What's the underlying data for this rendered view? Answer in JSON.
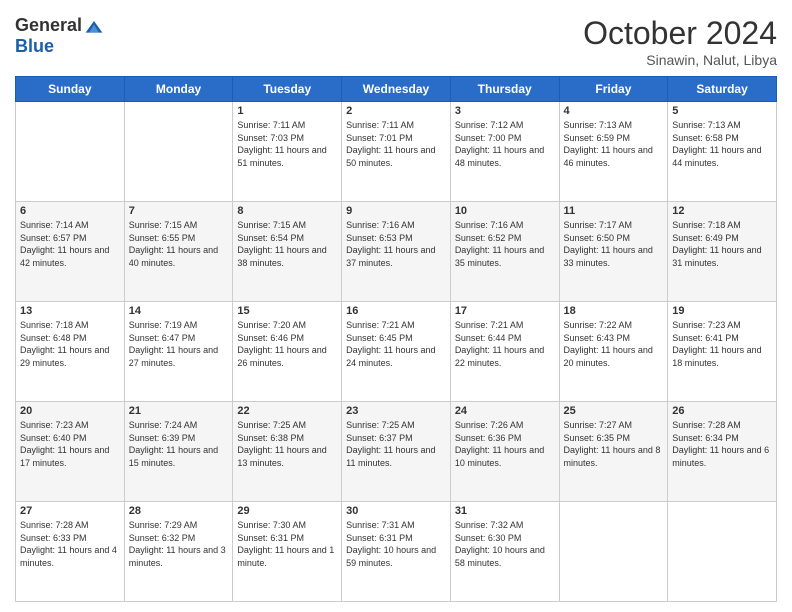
{
  "header": {
    "logo_general": "General",
    "logo_blue": "Blue",
    "month": "October 2024",
    "location": "Sinawin, Nalut, Libya"
  },
  "days_of_week": [
    "Sunday",
    "Monday",
    "Tuesday",
    "Wednesday",
    "Thursday",
    "Friday",
    "Saturday"
  ],
  "weeks": [
    [
      {
        "day": "",
        "sunrise": "",
        "sunset": "",
        "daylight": ""
      },
      {
        "day": "",
        "sunrise": "",
        "sunset": "",
        "daylight": ""
      },
      {
        "day": "1",
        "sunrise": "Sunrise: 7:11 AM",
        "sunset": "Sunset: 7:03 PM",
        "daylight": "Daylight: 11 hours and 51 minutes."
      },
      {
        "day": "2",
        "sunrise": "Sunrise: 7:11 AM",
        "sunset": "Sunset: 7:01 PM",
        "daylight": "Daylight: 11 hours and 50 minutes."
      },
      {
        "day": "3",
        "sunrise": "Sunrise: 7:12 AM",
        "sunset": "Sunset: 7:00 PM",
        "daylight": "Daylight: 11 hours and 48 minutes."
      },
      {
        "day": "4",
        "sunrise": "Sunrise: 7:13 AM",
        "sunset": "Sunset: 6:59 PM",
        "daylight": "Daylight: 11 hours and 46 minutes."
      },
      {
        "day": "5",
        "sunrise": "Sunrise: 7:13 AM",
        "sunset": "Sunset: 6:58 PM",
        "daylight": "Daylight: 11 hours and 44 minutes."
      }
    ],
    [
      {
        "day": "6",
        "sunrise": "Sunrise: 7:14 AM",
        "sunset": "Sunset: 6:57 PM",
        "daylight": "Daylight: 11 hours and 42 minutes."
      },
      {
        "day": "7",
        "sunrise": "Sunrise: 7:15 AM",
        "sunset": "Sunset: 6:55 PM",
        "daylight": "Daylight: 11 hours and 40 minutes."
      },
      {
        "day": "8",
        "sunrise": "Sunrise: 7:15 AM",
        "sunset": "Sunset: 6:54 PM",
        "daylight": "Daylight: 11 hours and 38 minutes."
      },
      {
        "day": "9",
        "sunrise": "Sunrise: 7:16 AM",
        "sunset": "Sunset: 6:53 PM",
        "daylight": "Daylight: 11 hours and 37 minutes."
      },
      {
        "day": "10",
        "sunrise": "Sunrise: 7:16 AM",
        "sunset": "Sunset: 6:52 PM",
        "daylight": "Daylight: 11 hours and 35 minutes."
      },
      {
        "day": "11",
        "sunrise": "Sunrise: 7:17 AM",
        "sunset": "Sunset: 6:50 PM",
        "daylight": "Daylight: 11 hours and 33 minutes."
      },
      {
        "day": "12",
        "sunrise": "Sunrise: 7:18 AM",
        "sunset": "Sunset: 6:49 PM",
        "daylight": "Daylight: 11 hours and 31 minutes."
      }
    ],
    [
      {
        "day": "13",
        "sunrise": "Sunrise: 7:18 AM",
        "sunset": "Sunset: 6:48 PM",
        "daylight": "Daylight: 11 hours and 29 minutes."
      },
      {
        "day": "14",
        "sunrise": "Sunrise: 7:19 AM",
        "sunset": "Sunset: 6:47 PM",
        "daylight": "Daylight: 11 hours and 27 minutes."
      },
      {
        "day": "15",
        "sunrise": "Sunrise: 7:20 AM",
        "sunset": "Sunset: 6:46 PM",
        "daylight": "Daylight: 11 hours and 26 minutes."
      },
      {
        "day": "16",
        "sunrise": "Sunrise: 7:21 AM",
        "sunset": "Sunset: 6:45 PM",
        "daylight": "Daylight: 11 hours and 24 minutes."
      },
      {
        "day": "17",
        "sunrise": "Sunrise: 7:21 AM",
        "sunset": "Sunset: 6:44 PM",
        "daylight": "Daylight: 11 hours and 22 minutes."
      },
      {
        "day": "18",
        "sunrise": "Sunrise: 7:22 AM",
        "sunset": "Sunset: 6:43 PM",
        "daylight": "Daylight: 11 hours and 20 minutes."
      },
      {
        "day": "19",
        "sunrise": "Sunrise: 7:23 AM",
        "sunset": "Sunset: 6:41 PM",
        "daylight": "Daylight: 11 hours and 18 minutes."
      }
    ],
    [
      {
        "day": "20",
        "sunrise": "Sunrise: 7:23 AM",
        "sunset": "Sunset: 6:40 PM",
        "daylight": "Daylight: 11 hours and 17 minutes."
      },
      {
        "day": "21",
        "sunrise": "Sunrise: 7:24 AM",
        "sunset": "Sunset: 6:39 PM",
        "daylight": "Daylight: 11 hours and 15 minutes."
      },
      {
        "day": "22",
        "sunrise": "Sunrise: 7:25 AM",
        "sunset": "Sunset: 6:38 PM",
        "daylight": "Daylight: 11 hours and 13 minutes."
      },
      {
        "day": "23",
        "sunrise": "Sunrise: 7:25 AM",
        "sunset": "Sunset: 6:37 PM",
        "daylight": "Daylight: 11 hours and 11 minutes."
      },
      {
        "day": "24",
        "sunrise": "Sunrise: 7:26 AM",
        "sunset": "Sunset: 6:36 PM",
        "daylight": "Daylight: 11 hours and 10 minutes."
      },
      {
        "day": "25",
        "sunrise": "Sunrise: 7:27 AM",
        "sunset": "Sunset: 6:35 PM",
        "daylight": "Daylight: 11 hours and 8 minutes."
      },
      {
        "day": "26",
        "sunrise": "Sunrise: 7:28 AM",
        "sunset": "Sunset: 6:34 PM",
        "daylight": "Daylight: 11 hours and 6 minutes."
      }
    ],
    [
      {
        "day": "27",
        "sunrise": "Sunrise: 7:28 AM",
        "sunset": "Sunset: 6:33 PM",
        "daylight": "Daylight: 11 hours and 4 minutes."
      },
      {
        "day": "28",
        "sunrise": "Sunrise: 7:29 AM",
        "sunset": "Sunset: 6:32 PM",
        "daylight": "Daylight: 11 hours and 3 minutes."
      },
      {
        "day": "29",
        "sunrise": "Sunrise: 7:30 AM",
        "sunset": "Sunset: 6:31 PM",
        "daylight": "Daylight: 11 hours and 1 minute."
      },
      {
        "day": "30",
        "sunrise": "Sunrise: 7:31 AM",
        "sunset": "Sunset: 6:31 PM",
        "daylight": "Daylight: 10 hours and 59 minutes."
      },
      {
        "day": "31",
        "sunrise": "Sunrise: 7:32 AM",
        "sunset": "Sunset: 6:30 PM",
        "daylight": "Daylight: 10 hours and 58 minutes."
      },
      {
        "day": "",
        "sunrise": "",
        "sunset": "",
        "daylight": ""
      },
      {
        "day": "",
        "sunrise": "",
        "sunset": "",
        "daylight": ""
      }
    ]
  ]
}
